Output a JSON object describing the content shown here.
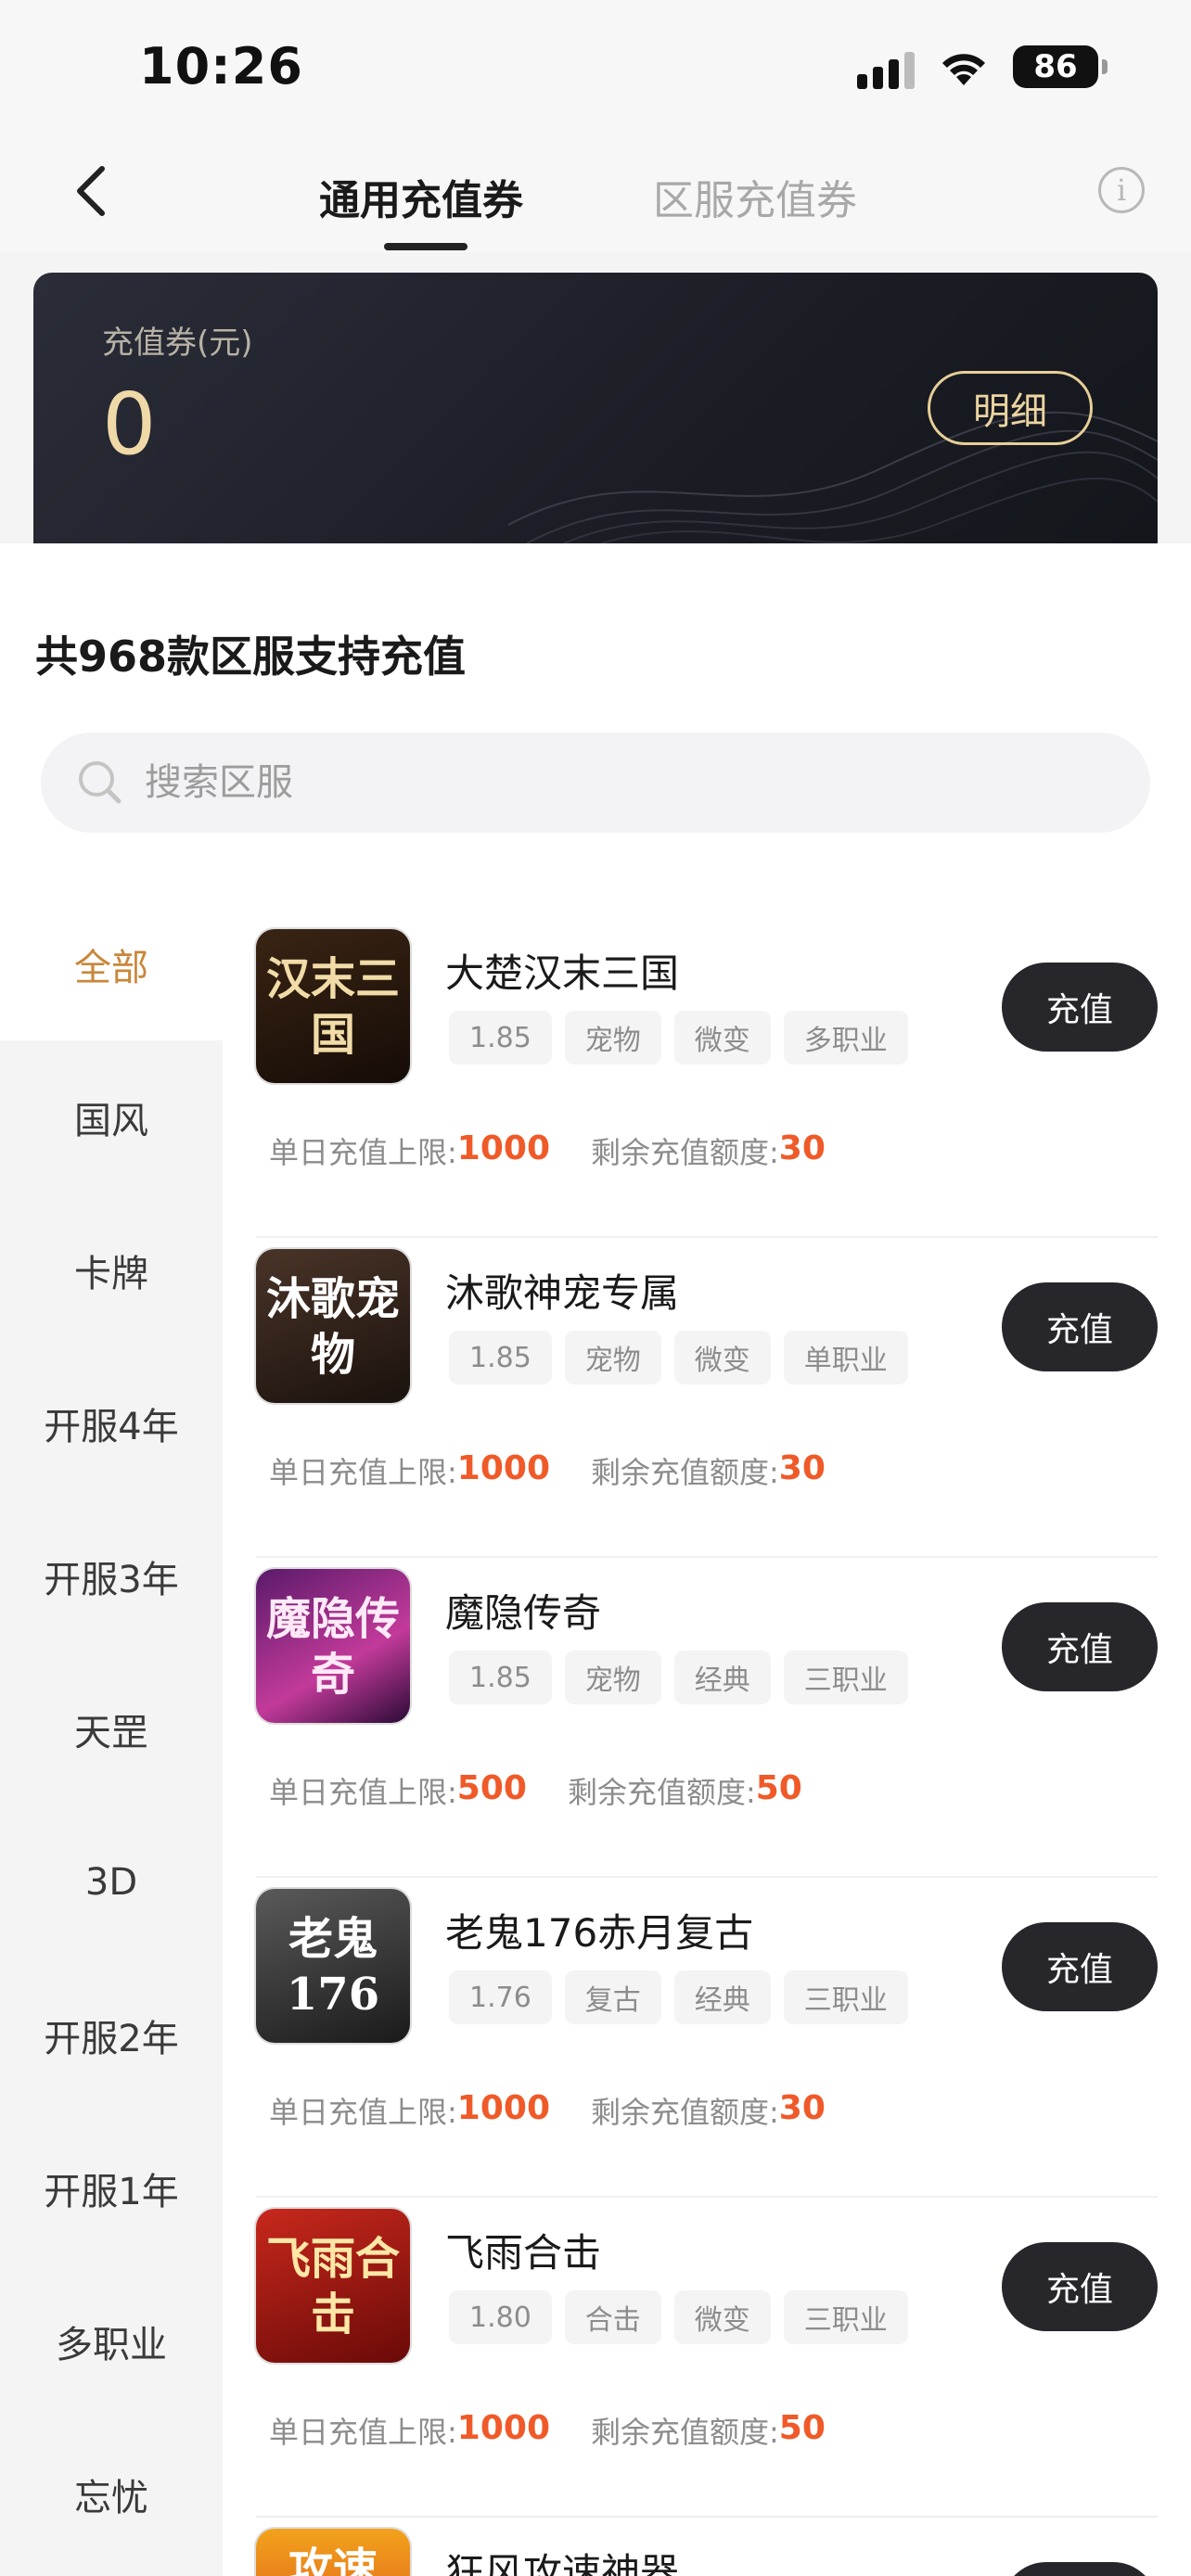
{
  "status_bar": {
    "time": "10:26",
    "battery": "86"
  },
  "tabs": {
    "active": "通用充值券",
    "inactive": "区服充值券"
  },
  "voucher": {
    "label": "充值券(元)",
    "value": "0",
    "detail_button": "明细"
  },
  "count_title": "共968款区服支持充值",
  "search": {
    "placeholder": "搜索区服"
  },
  "categories": [
    {
      "label": "全部",
      "active": true
    },
    {
      "label": "国风"
    },
    {
      "label": "卡牌"
    },
    {
      "label": "开服4年"
    },
    {
      "label": "开服3年"
    },
    {
      "label": "天罡"
    },
    {
      "label": "3D"
    },
    {
      "label": "开服2年"
    },
    {
      "label": "开服1年"
    },
    {
      "label": "多职业"
    },
    {
      "label": "忘忧"
    }
  ],
  "limit_labels": {
    "daily": "单日充值上限:",
    "remaining": "剩余充值额度:"
  },
  "charge_label": "充值",
  "games": [
    {
      "name": "大楚汉末三国",
      "tags": [
        "1.85",
        "宠物",
        "微变",
        "多职业"
      ],
      "daily_limit": "1000",
      "remaining": "30",
      "thumb_text": "汉末三国"
    },
    {
      "name": "沐歌神宠专属",
      "tags": [
        "1.85",
        "宠物",
        "微变",
        "单职业"
      ],
      "daily_limit": "1000",
      "remaining": "30",
      "thumb_text": "沐歌宠物"
    },
    {
      "name": "魔隐传奇",
      "tags": [
        "1.85",
        "宠物",
        "经典",
        "三职业"
      ],
      "daily_limit": "500",
      "remaining": "50",
      "thumb_text": "魔隐传奇"
    },
    {
      "name": "老鬼176赤月复古",
      "tags": [
        "1.76",
        "复古",
        "经典",
        "三职业"
      ],
      "daily_limit": "1000",
      "remaining": "30",
      "thumb_text": "老鬼176"
    },
    {
      "name": "飞雨合击",
      "tags": [
        "1.80",
        "合击",
        "微变",
        "三职业"
      ],
      "daily_limit": "1000",
      "remaining": "50",
      "thumb_text": "飞雨合击"
    },
    {
      "name": "狂风攻速神器",
      "thumb_text": "攻速"
    }
  ]
}
